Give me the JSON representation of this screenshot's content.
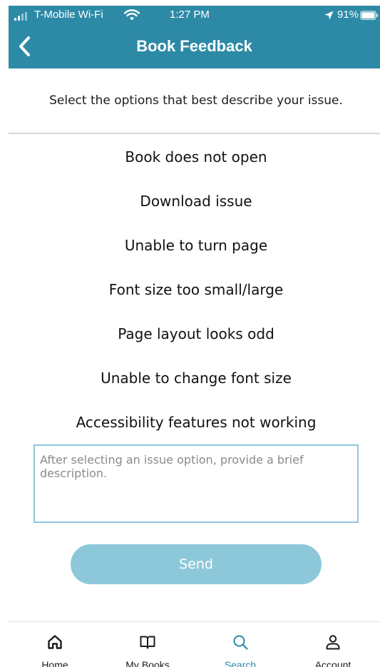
{
  "status_bar": {
    "carrier": "T-Mobile Wi-Fi",
    "time": "1:27 PM",
    "battery": "91%"
  },
  "nav": {
    "title": "Book Feedback",
    "back_icon": "chevron-left-icon"
  },
  "instruction": "Select the options that best describe your issue.",
  "options": [
    "Book does not open",
    "Download issue",
    "Unable to turn page",
    "Font size too small/large",
    "Page layout looks odd",
    "Unable to change font size",
    "Accessibility features not working"
  ],
  "description": {
    "value": "",
    "placeholder": "After selecting an issue option, provide a brief description."
  },
  "send_label": "Send",
  "tabs": [
    {
      "label": "Home",
      "icon": "home-icon"
    },
    {
      "label": "My Books",
      "icon": "book-icon"
    },
    {
      "label": "Search",
      "icon": "search-icon",
      "active": true
    },
    {
      "label": "Account",
      "icon": "account-icon"
    }
  ],
  "colors": {
    "accent": "#2d8aa7",
    "send_button": "#8dc8da",
    "input_border": "#8ec8dc",
    "text": "#111111"
  }
}
